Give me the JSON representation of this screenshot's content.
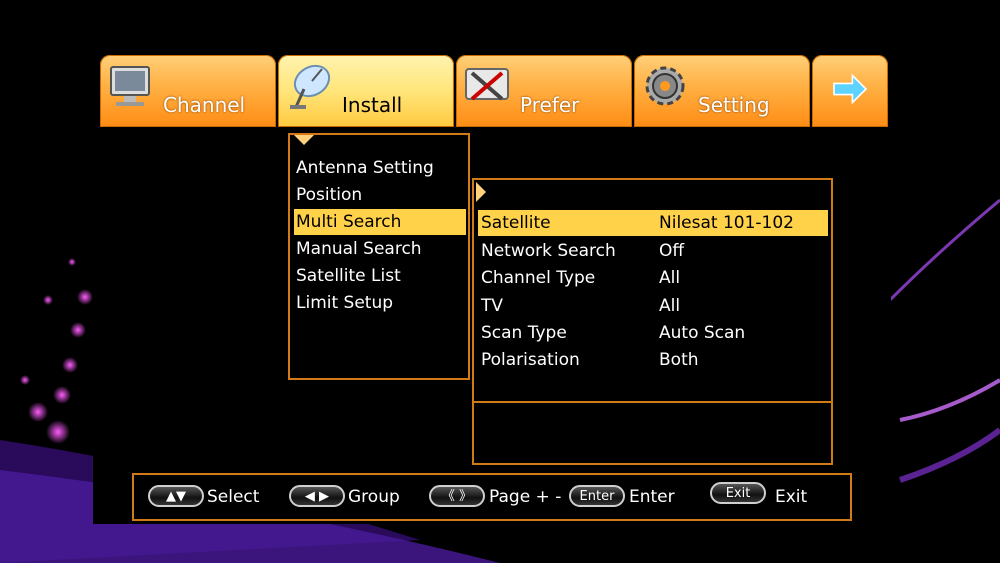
{
  "tabs": [
    {
      "label": "Channel",
      "icon": "monitor-icon",
      "active": false
    },
    {
      "label": "Install",
      "icon": "satellite-dish-icon",
      "active": true
    },
    {
      "label": "Prefer",
      "icon": "tools-icon",
      "active": false
    },
    {
      "label": "Setting",
      "icon": "gear-icon",
      "active": false
    },
    {
      "label": "",
      "icon": "arrow-right-icon",
      "active": false
    }
  ],
  "submenu": {
    "items": [
      "Antenna Setting",
      "Position",
      "Multi Search",
      "Manual Search",
      "Satellite List",
      "Limit Setup"
    ],
    "selected_index": 2
  },
  "detail": {
    "rows": [
      {
        "label": "Satellite",
        "value": "Nilesat 101-102"
      },
      {
        "label": "Network Search",
        "value": "Off"
      },
      {
        "label": "Channel Type",
        "value": "All"
      },
      {
        "label": "TV",
        "value": "All"
      },
      {
        "label": "Scan Type",
        "value": "Auto Scan"
      },
      {
        "label": "Polarisation",
        "value": "Both"
      }
    ],
    "selected_index": 0
  },
  "help": {
    "select": {
      "key": "▲▼",
      "label": "Select"
    },
    "group": {
      "key": "◀ ▶",
      "label": "Group"
    },
    "page": {
      "key": "《 》",
      "label": "Page + -"
    },
    "enter": {
      "key": "Enter",
      "label": "Enter"
    },
    "exit": {
      "key": "Exit",
      "label": "Exit"
    }
  },
  "colors": {
    "accent": "#ffd24a",
    "border": "#d07a18",
    "tab": "#ff9a1e"
  }
}
